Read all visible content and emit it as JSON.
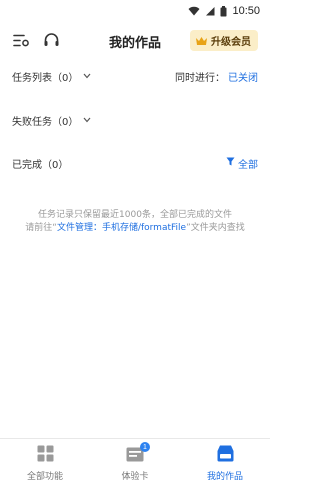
{
  "status_bar": {
    "time": "10:50"
  },
  "toolbar": {
    "title": "我的作品",
    "upgrade_label": "升级会员"
  },
  "task_list": {
    "label": "任务列表（0）"
  },
  "concurrent": {
    "label": "同时进行：",
    "value": "已关闭"
  },
  "failed": {
    "label": "失败任务（0）"
  },
  "completed": {
    "label": "已完成（0）",
    "filter_label": "全部"
  },
  "info": {
    "line1": "任务记录只保留最近1000条，全部已完成的文件",
    "line2_prefix": "请前往“",
    "line2_link": "文件管理：手机存储/formatFile",
    "line2_suffix": "”文件夹内查找"
  },
  "bottom_nav": {
    "items": [
      {
        "label": "全部功能",
        "icon": "grid-icon"
      },
      {
        "label": "体验卡",
        "icon": "card-icon",
        "badge": "1"
      },
      {
        "label": "我的作品",
        "icon": "works-icon",
        "active": true
      }
    ]
  },
  "colors": {
    "accent": "#1f6fe0",
    "upgrade_bg": "#fbeec8"
  }
}
